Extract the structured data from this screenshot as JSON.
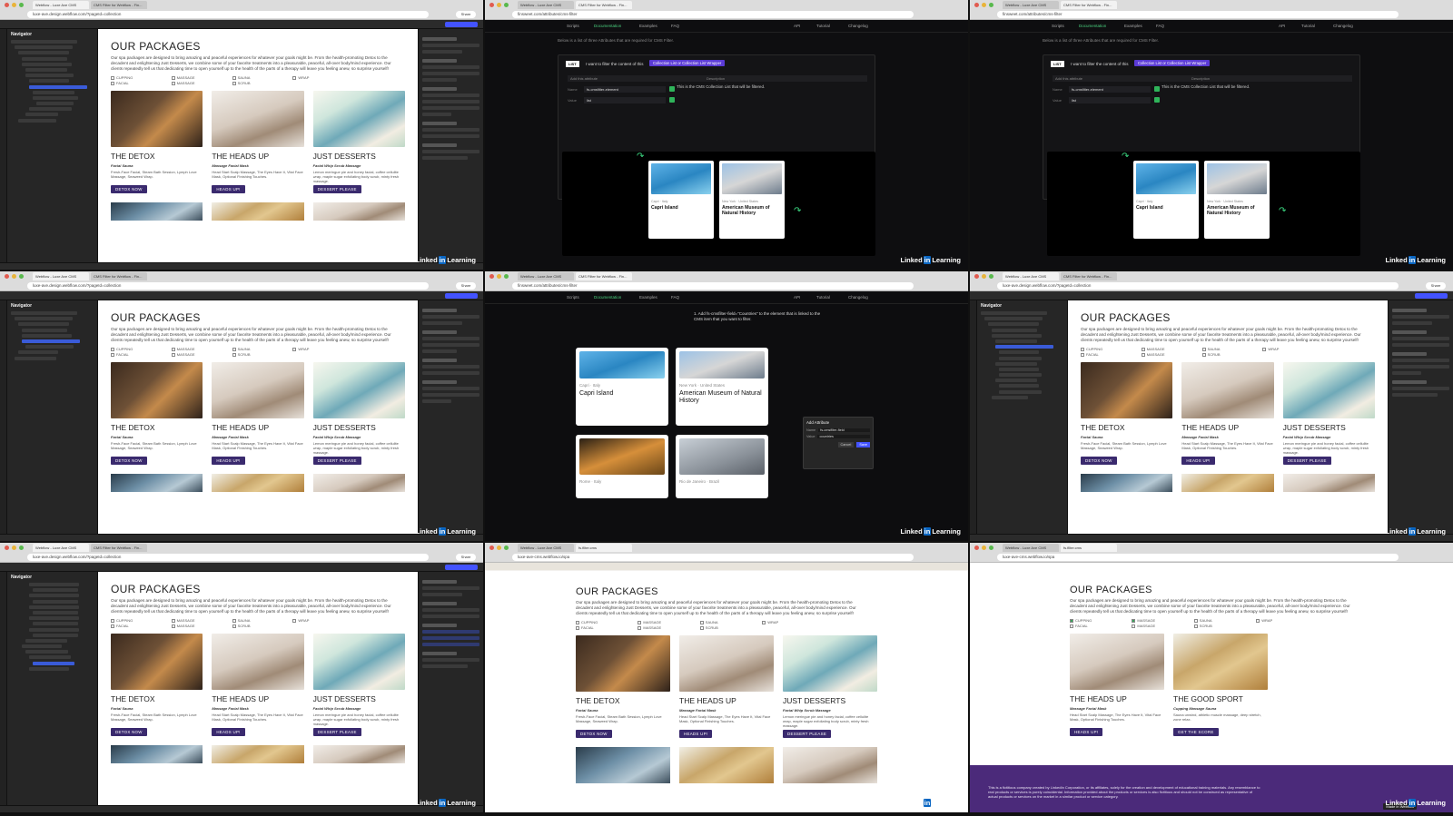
{
  "browser": {
    "tabs": [
      "Webflow - Luxe Ave CMS",
      "CMS Filter for Webflow - Fin...",
      "fs.filter.cms"
    ],
    "url": "luxe-ave.design.webflow.com/?pageId=collection",
    "docs_url": "finsweet.com/attributes/cms-filter",
    "live_url": "luxe-ave-cms.webflow.io/spa",
    "share": "Share"
  },
  "navigator": {
    "title": "Navigator"
  },
  "site": {
    "page_title": "OUR PACKAGES",
    "intro": "Our spa packages are designed to bring amazing and peaceful experiences for whatever your goals might be. From the health-promoting Detox to the decadent and enlightening Just Desserts, we combine some of your favorite treatments into a pleasurable, peaceful, all-over body/mind experience. Our clients repeatedly tell us that dedicating time to open yourself up to the health of the parts of a therapy will leave you feeling anew, so surprise yourself!",
    "filters": [
      "CUPPING",
      "FACIAL",
      "MASSAGE",
      "MASSAGE",
      "SAUNA",
      "SCRUB",
      "WRAP"
    ],
    "packages": [
      {
        "title": "THE DETOX",
        "tags": "Facial Sauna",
        "desc": "Fresh-Face Facial, Steam Bath Session, Lymph Love Massage, Seaweed Wrap.",
        "button": "DETOX NOW"
      },
      {
        "title": "THE HEADS UP",
        "tags": "Massage Facial Mask",
        "desc": "Head Start Scalp Massage, The Eyes Have It, Vital Face Mask, Optional Finishing Touches.",
        "button": "HEADS UP!"
      },
      {
        "title": "JUST DESSERTS",
        "tags": "Facial Whip Scrub Massage",
        "desc": "Lemon meringue pie and honey facial, coffee cellulite wrap, maple sugar exfoliating body scrub, minty fresh massage.",
        "button": "DESSERT PLEASE"
      },
      {
        "title": "THE GOOD SPORT",
        "tags": "Cupping Massage Sauna",
        "desc": "Sauna unwind, athletic muscle massage, deep stretch, zone relax.",
        "button": "GET THE SCORE"
      }
    ]
  },
  "docs": {
    "nav": [
      "Scripts",
      "Documentation",
      "Examples",
      "FAQ",
      "API",
      "Tutorial",
      "Changelog"
    ],
    "intro": "Below is a list of three Attributes that are required for CMS Filter.",
    "list_tag": "LIST",
    "learn": "I want to filter the content of this",
    "chip": "Collection List or Collection List Wrapper",
    "col_attribute": "Add this attribute",
    "col_description": "Description",
    "name_label": "Name",
    "name_value": "fs-cmsfilter-element",
    "value_label": "Value",
    "value_value": "list",
    "description": "This is the CMS Collection List that will be filtered.",
    "check": "Check the example here",
    "zoom_step": "1. Add fs-cmsfilter-field=\"Countries\" to the element that is linked to the CMS item that you want to filter.",
    "cards": [
      {
        "loc": "Capri · Italy",
        "name": "Capri Island"
      },
      {
        "loc": "New York · United States",
        "name": "American Museum of Natural History"
      },
      {
        "loc": "Rome · Italy",
        "name": ""
      },
      {
        "loc": "Rio de Janeiro · Brazil",
        "name": ""
      }
    ],
    "dialog": {
      "title": "Add Attribute",
      "name_label": "Name",
      "name_value": "fs-cmsfilter-field",
      "value_label": "Value",
      "value_value": "countries",
      "cancel": "Cancel",
      "save": "Save"
    }
  },
  "live": {
    "footer": "This is a fictitious company created by LinkedIn Corporation, or its affiliates, solely for the creation and development of educational training materials. Any resemblance to real products or services is purely coincidental. Information provided about the products or services is also fictitious and should not be construed as representative of actual products or services on the market in a similar product or service category.",
    "madein": "Made in Webflow"
  },
  "watermark": {
    "pre": "Linked",
    "in": "in",
    "post": "Learning"
  },
  "colors": {
    "button": "#3a2a6e",
    "accent_blue": "#4353ff",
    "accent_green": "#3ddc84",
    "chip_purple": "#5b3bd6"
  }
}
